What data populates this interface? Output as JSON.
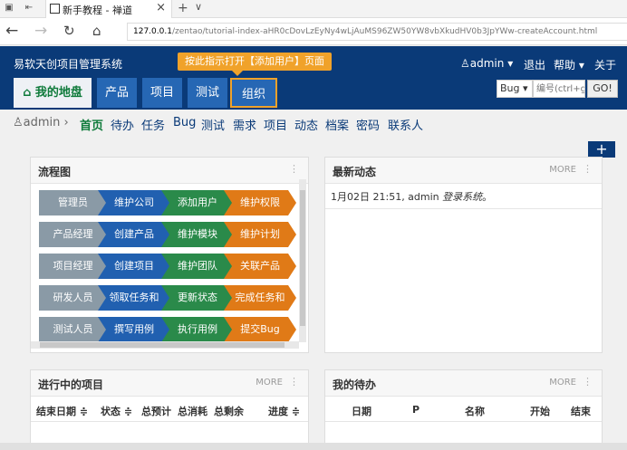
{
  "browser": {
    "tab_title": "新手教程 - 禅道",
    "url_host": "127.0.0.1",
    "url_path": "/zentao/tutorial-index-aHR0cDovLzEyNy4wLjAuMS96ZW50YW8vbXkudHV0b3JpYWw-createAccount.html"
  },
  "header": {
    "brand": "易软天创项目管理系统",
    "tooltip": "按此指示打开【添加用户】页面",
    "user": "admin",
    "logout": "退出",
    "help": "帮助",
    "about": "关于",
    "search_type": "Bug",
    "search_placeholder": "编号(ctrl+g",
    "go": "GO!"
  },
  "mainnav": [
    "我的地盘",
    "产品",
    "项目",
    "测试",
    "组织"
  ],
  "subnav": {
    "user": "admin",
    "items": [
      "首页",
      "待办",
      "任务",
      "Bug",
      "测试",
      "需求",
      "项目",
      "动态",
      "档案",
      "密码",
      "联系人"
    ]
  },
  "flow": {
    "title": "流程图",
    "rows": [
      [
        "管理员",
        "维护公司",
        "添加用户",
        "维护权限"
      ],
      [
        "产品经理",
        "创建产品",
        "维护模块",
        "维护计划"
      ],
      [
        "项目经理",
        "创建项目",
        "维护团队",
        "关联产品"
      ],
      [
        "研发人员",
        "领取任务和",
        "更新状态",
        "完成任务和"
      ],
      [
        "测试人员",
        "撰写用例",
        "执行用例",
        "提交Bug"
      ]
    ]
  },
  "dynamic": {
    "title": "最新动态",
    "more": "MORE",
    "entry_prefix": "1月02日 21:51, admin ",
    "entry_action": "登录系统",
    "entry_suffix": "。"
  },
  "projects": {
    "title": "进行中的项目",
    "more": "MORE",
    "headers": [
      "结束日期 ≑",
      "状态 ≑",
      "总预计",
      "总消耗",
      "总剩余",
      "进度 ≑"
    ]
  },
  "todo": {
    "title": "我的待办",
    "more": "MORE",
    "headers": [
      "日期",
      "P",
      "名称",
      "开始",
      "结束"
    ]
  },
  "colors": {
    "header": "#0a3a78",
    "nav": "#2667b4",
    "highlight": "#f0a22a",
    "active_green": "#0e7a3a"
  }
}
